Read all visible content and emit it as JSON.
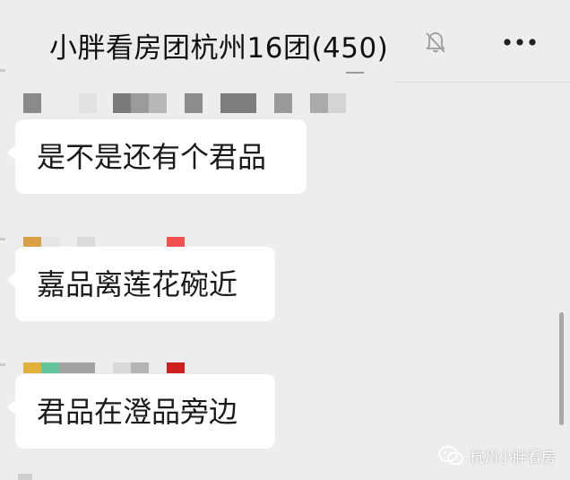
{
  "chat": {
    "title": "小胖看房团杭州16团(450)",
    "muted_icon": "bell-muted-icon",
    "more_icon": "more-dots-icon"
  },
  "messages": [
    {
      "text": "是不是还有个君品",
      "sender_name_visibility": "pixelated"
    },
    {
      "text": "嘉品离莲花碗近",
      "sender_name_visibility": "pixelated"
    },
    {
      "text": "君品在澄品旁边",
      "sender_name_visibility": "pixelated"
    }
  ],
  "watermark": {
    "label": "杭州小胖看房",
    "icon": "wechat-logo-icon"
  },
  "colors": {
    "background": "#ededed",
    "bubble": "#ffffff",
    "text": "#1a1a1a"
  }
}
